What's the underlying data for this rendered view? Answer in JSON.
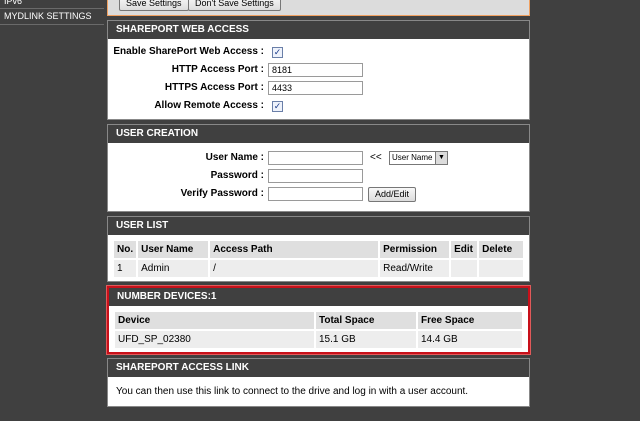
{
  "sidebar": {
    "items": [
      {
        "label": "IPv6"
      },
      {
        "label": "MYDLINK SETTINGS"
      }
    ]
  },
  "top": {
    "save_label": "Save Settings",
    "dont_save_label": "Don't Save Settings"
  },
  "shareport": {
    "title": "SHAREPORT WEB ACCESS",
    "enable_label": "Enable SharePort Web Access :",
    "http_label": "HTTP Access Port :",
    "http_value": "8181",
    "https_label": "HTTPS Access Port :",
    "https_value": "4433",
    "remote_label": "Allow Remote Access :",
    "check_glyph": "✓"
  },
  "user_creation": {
    "title": "USER CREATION",
    "username_label": "User Name :",
    "password_label": "Password :",
    "verify_label": "Verify Password :",
    "arrow_text": "<<",
    "select_value": "User Name",
    "add_edit_label": "Add/Edit"
  },
  "user_list": {
    "title": "USER LIST",
    "columns": [
      "No.",
      "User Name",
      "Access Path",
      "Permission",
      "Edit",
      "Delete"
    ],
    "rows": [
      [
        "1",
        "Admin",
        "/",
        "Read/Write",
        "",
        ""
      ]
    ]
  },
  "devices": {
    "title": "NUMBER DEVICES:1",
    "columns": [
      "Device",
      "Total Space",
      "Free Space"
    ],
    "rows": [
      [
        "UFD_SP_02380",
        "15.1 GB",
        "14.4 GB"
      ]
    ]
  },
  "access_link": {
    "title": "SHAREPORT ACCESS LINK",
    "text": "You can then use this link to connect to the drive and log in with a user account."
  },
  "colors": {
    "header_bg": "#404040",
    "highlight": "#c8101a"
  }
}
